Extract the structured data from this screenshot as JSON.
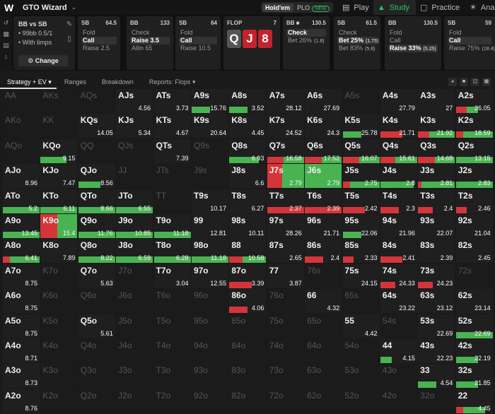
{
  "app": {
    "title": "GTO Wizard",
    "logo_letter": "W"
  },
  "game_toggle": {
    "holdem": "Hold'em",
    "plo": "PLO",
    "new_badge": "NEW"
  },
  "nav": {
    "play": "Play",
    "study": "Study",
    "practice": "Practice",
    "analyze": "Ana"
  },
  "setup": {
    "matchup": "BB vs SB",
    "stack": "99bb 0.5/1",
    "limps": "With limps",
    "change": "Change"
  },
  "actions": [
    {
      "pos": "SB",
      "stack": "64.5",
      "options": [
        {
          "label": "Fold"
        },
        {
          "label": "Call",
          "selected": true
        },
        {
          "label": "Raise 2.5"
        }
      ]
    },
    {
      "pos": "BB",
      "stack": "133",
      "options": [
        {
          "label": "Check"
        },
        {
          "label": "Raise 3.5",
          "selected": true
        },
        {
          "label": "Allin 65"
        }
      ]
    },
    {
      "pos": "SB",
      "stack": "64",
      "options": [
        {
          "label": "Fold"
        },
        {
          "label": "Call",
          "selected": true
        },
        {
          "label": "Raise 10.5"
        }
      ]
    },
    {
      "pos": "BB",
      "stack": "130.5",
      "options": [
        {
          "label": "Check",
          "selected": true
        },
        {
          "label": "Bet 26%",
          "pct": "(1.8)"
        }
      ]
    },
    {
      "pos": "SB",
      "stack": "61.5",
      "options": [
        {
          "label": "Check"
        },
        {
          "label": "Bet 25%",
          "pct": "(1.75)",
          "selected": true
        },
        {
          "label": "Bet 83%",
          "pct": "(5.8)"
        }
      ]
    },
    {
      "pos": "BB",
      "stack": "130.5",
      "options": [
        {
          "label": "Fold"
        },
        {
          "label": "Call"
        },
        {
          "label": "Raise 33%",
          "pct": "(5.25)",
          "selected": true
        }
      ]
    },
    {
      "pos": "SB",
      "stack": "59",
      "options": [
        {
          "label": "Fold"
        },
        {
          "label": "Call",
          "selected": true
        },
        {
          "label": "Raise 75%",
          "pct": "(18.4)"
        }
      ]
    }
  ],
  "flop": {
    "label": "FLOP",
    "pot": "7",
    "cards": [
      "Q",
      "J",
      "8"
    ]
  },
  "tabs": {
    "strategy": "Strategy + EV",
    "ranges": "Ranges",
    "breakdown": "Breakdown",
    "reports": "Reports: Flops"
  },
  "colors": {
    "red": "#d4353b",
    "green": "#49b352",
    "yellow": "#c9c93e"
  },
  "grid": [
    [
      {
        "h": "AA",
        "f": 1
      },
      {
        "h": "AKs",
        "f": 1
      },
      {
        "h": "AQs",
        "f": 1
      },
      {
        "h": "AJs",
        "ev": "4.56"
      },
      {
        "h": "ATs",
        "ev": "3.73"
      },
      {
        "h": "A9s",
        "ev": "15.76",
        "g": 0.5
      },
      {
        "h": "A8s",
        "ev": "3.52",
        "g": 0.5
      },
      {
        "h": "A7s",
        "ev": "28.12"
      },
      {
        "h": "A6s",
        "ev": "27.69"
      },
      {
        "h": "A5s",
        "f": 1
      },
      {
        "h": "A4s",
        "ev": "27.79"
      },
      {
        "h": "A3s",
        "ev": "27"
      },
      {
        "h": "A2s",
        "ev": "26.05",
        "r": 0.3,
        "g": 0.3
      }
    ],
    [
      {
        "h": "AKo",
        "f": 1
      },
      {
        "h": "KK",
        "f": 1
      },
      {
        "h": "KQs",
        "ev": "14.05"
      },
      {
        "h": "KJs",
        "ev": "5.34"
      },
      {
        "h": "KTs",
        "ev": "4.67"
      },
      {
        "h": "K9s",
        "ev": "20.64"
      },
      {
        "h": "K8s",
        "ev": "4.45"
      },
      {
        "h": "K7s",
        "ev": "24.52"
      },
      {
        "h": "K6s",
        "ev": "24.3"
      },
      {
        "h": "K5s",
        "ev": "25.78",
        "g": 0.5
      },
      {
        "h": "K4s",
        "ev": "21.71",
        "r": 0.6
      },
      {
        "h": "K3s",
        "ev": "21.92",
        "r": 0.3,
        "g": 0.7
      },
      {
        "h": "K2s",
        "ev": "18.59",
        "r": 0.2,
        "g": 0.8
      }
    ],
    [
      {
        "h": "AQo",
        "f": 1
      },
      {
        "h": "KQo",
        "ev": "9.15",
        "g": 0.7
      },
      {
        "h": "QQ",
        "f": 1
      },
      {
        "h": "QJs",
        "f": 1
      },
      {
        "h": "QTs",
        "ev": "7.39"
      },
      {
        "h": "Q9s",
        "f": 1
      },
      {
        "h": "Q8s",
        "ev": "6.93",
        "g": 0.8
      },
      {
        "h": "Q7s",
        "ev": "16.58",
        "r": 0.45,
        "g": 0.55
      },
      {
        "h": "Q6s",
        "ev": "17.52",
        "r": 0.45,
        "g": 0.55
      },
      {
        "h": "Q5s",
        "ev": "16.07",
        "r": 0.45,
        "g": 0.55
      },
      {
        "h": "Q4s",
        "ev": "15.61",
        "r": 0.4,
        "g": 0.6
      },
      {
        "h": "Q3s",
        "ev": "14.68",
        "r": 0.45,
        "g": 0.55
      },
      {
        "h": "Q2s",
        "ev": "13.15",
        "g": 1
      }
    ],
    [
      {
        "h": "AJo",
        "ev": "8.96"
      },
      {
        "h": "KJo",
        "ev": "7.47"
      },
      {
        "h": "QJo",
        "ev": "8.56",
        "g": 0.6
      },
      {
        "h": "JJ",
        "f": 1
      },
      {
        "h": "JTs",
        "f": 1
      },
      {
        "h": "J9s",
        "f": 1
      },
      {
        "h": "J8s",
        "ev": "6.6"
      },
      {
        "h": "J7s",
        "ev": "2.79",
        "full": 1,
        "r": 0.4,
        "g": 0.6
      },
      {
        "h": "J6s",
        "ev": "2.79",
        "full": 1,
        "g": 1
      },
      {
        "h": "J5s",
        "ev": "2.75",
        "r": 0.2,
        "g": 0.8
      },
      {
        "h": "J4s",
        "ev": "2.8",
        "g": 0.9
      },
      {
        "h": "J3s",
        "ev": "2.81",
        "r": 0.1,
        "g": 0.9
      },
      {
        "h": "J2s",
        "ev": "2.83",
        "g": 1
      }
    ],
    [
      {
        "h": "ATo",
        "ev": "5.2",
        "g": 1
      },
      {
        "h": "KTo",
        "ev": "6.11",
        "g": 1
      },
      {
        "h": "QTo",
        "ev": "8.66",
        "g": 1
      },
      {
        "h": "JTo",
        "ev": "6.55",
        "g": 1
      },
      {
        "h": "TT",
        "f": 1
      },
      {
        "h": "T9s",
        "ev": "10.17"
      },
      {
        "h": "T8s",
        "ev": "6.27"
      },
      {
        "h": "T7s",
        "ev": "2.37",
        "r": 1
      },
      {
        "h": "T6s",
        "ev": "2.39",
        "r": 1
      },
      {
        "h": "T5s",
        "ev": "2.42",
        "r": 0.6
      },
      {
        "h": "T4s",
        "ev": "2.3",
        "r": 0.5
      },
      {
        "h": "T3s",
        "ev": "2.4",
        "r": 0.4
      },
      {
        "h": "T2s",
        "ev": "2.46",
        "r": 0.3
      }
    ],
    [
      {
        "h": "A9o",
        "ev": "13.45",
        "g": 1
      },
      {
        "h": "K9o",
        "ev": "15.4",
        "full": 1,
        "r": 0.45,
        "g": 0.55
      },
      {
        "h": "Q9o",
        "ev": "11.76",
        "g": 1
      },
      {
        "h": "J9o",
        "ev": "10.85",
        "g": 1
      },
      {
        "h": "T9o",
        "ev": "11.18",
        "g": 1
      },
      {
        "h": "99",
        "ev": "12.81"
      },
      {
        "h": "98s",
        "ev": "10.11"
      },
      {
        "h": "97s",
        "ev": "28.26"
      },
      {
        "h": "96s",
        "ev": "21.71"
      },
      {
        "h": "95s",
        "ev": "22.06",
        "g": 0.5
      },
      {
        "h": "94s",
        "ev": "21.96"
      },
      {
        "h": "93s",
        "ev": "22.07"
      },
      {
        "h": "92s",
        "ev": "21.04"
      }
    ],
    [
      {
        "h": "A8o",
        "ev": "6.41",
        "r": 0.2,
        "g": 0.8
      },
      {
        "h": "K8o",
        "ev": "7.89"
      },
      {
        "h": "Q8o",
        "ev": "8.22",
        "g": 1
      },
      {
        "h": "J8o",
        "ev": "6.59",
        "g": 1
      },
      {
        "h": "T8o",
        "ev": "6.28",
        "g": 1
      },
      {
        "h": "98o",
        "ev": "11.18",
        "g": 1
      },
      {
        "h": "88",
        "ev": "10.58",
        "r": 0.35,
        "g": 0.65
      },
      {
        "h": "87s",
        "ev": "2.65"
      },
      {
        "h": "86s",
        "ev": "2.4",
        "r": 0.5
      },
      {
        "h": "85s",
        "ev": "2.33",
        "r": 0.3
      },
      {
        "h": "84s",
        "ev": "2.41",
        "r": 0.6
      },
      {
        "h": "83s",
        "ev": "2.39"
      },
      {
        "h": "82s",
        "ev": "2.45"
      }
    ],
    [
      {
        "h": "A7o",
        "ev": "8.75"
      },
      {
        "h": "K7o",
        "f": 1
      },
      {
        "h": "Q7o",
        "ev": "5.63"
      },
      {
        "h": "J7o",
        "f": 1
      },
      {
        "h": "T7o",
        "ev": "3.04"
      },
      {
        "h": "97o",
        "ev": "12.55"
      },
      {
        "h": "87o",
        "ev": "3.39",
        "r": 0.6
      },
      {
        "h": "77",
        "ev": "3.87"
      },
      {
        "h": "76s",
        "f": 1
      },
      {
        "h": "75s",
        "ev": "24.15"
      },
      {
        "h": "74s",
        "ev": "24.33",
        "r": 0.4
      },
      {
        "h": "73s",
        "ev": "24.23",
        "r": 0.4
      },
      {
        "h": "72s",
        "f": 1
      }
    ],
    [
      {
        "h": "A6o",
        "ev": "8.75"
      },
      {
        "h": "K6o",
        "f": 1
      },
      {
        "h": "Q6o",
        "f": 1
      },
      {
        "h": "J6o",
        "f": 1
      },
      {
        "h": "T6o",
        "f": 1
      },
      {
        "h": "96o",
        "f": 1
      },
      {
        "h": "86o",
        "ev": "4.06",
        "r": 0.5
      },
      {
        "h": "76o",
        "f": 1
      },
      {
        "h": "66",
        "ev": "4.32"
      },
      {
        "h": "65s",
        "f": 1
      },
      {
        "h": "64s",
        "ev": "23.22"
      },
      {
        "h": "63s",
        "ev": "23.12"
      },
      {
        "h": "62s",
        "ev": "23.14"
      }
    ],
    [
      {
        "h": "A5o",
        "ev": "8.75"
      },
      {
        "h": "K5o",
        "f": 1
      },
      {
        "h": "Q5o",
        "ev": "5.61"
      },
      {
        "h": "J5o",
        "f": 1
      },
      {
        "h": "T5o",
        "f": 1
      },
      {
        "h": "95o",
        "f": 1
      },
      {
        "h": "85o",
        "f": 1
      },
      {
        "h": "75o",
        "f": 1
      },
      {
        "h": "65o",
        "f": 1
      },
      {
        "h": "55",
        "ev": "4.42"
      },
      {
        "h": "54s",
        "f": 1
      },
      {
        "h": "53s",
        "ev": "22.69"
      },
      {
        "h": "52s",
        "ev": "22.69",
        "g": 1
      }
    ],
    [
      {
        "h": "A4o",
        "ev": "8.71"
      },
      {
        "h": "K4o",
        "f": 1
      },
      {
        "h": "Q4o",
        "f": 1
      },
      {
        "h": "J4o",
        "f": 1
      },
      {
        "h": "T4o",
        "f": 1
      },
      {
        "h": "94o",
        "f": 1
      },
      {
        "h": "84o",
        "f": 1
      },
      {
        "h": "74o",
        "f": 1
      },
      {
        "h": "64o",
        "f": 1
      },
      {
        "h": "54o",
        "f": 1
      },
      {
        "h": "44",
        "ev": "4.15",
        "g": 0.3
      },
      {
        "h": "43s",
        "ev": "22.23"
      },
      {
        "h": "42s",
        "ev": "22.19",
        "g": 0.6
      }
    ],
    [
      {
        "h": "A3o",
        "ev": "8.73"
      },
      {
        "h": "K3o",
        "f": 1
      },
      {
        "h": "Q3o",
        "f": 1
      },
      {
        "h": "J3o",
        "f": 1
      },
      {
        "h": "T3o",
        "f": 1
      },
      {
        "h": "93o",
        "f": 1
      },
      {
        "h": "83o",
        "f": 1
      },
      {
        "h": "73o",
        "f": 1
      },
      {
        "h": "63o",
        "f": 1
      },
      {
        "h": "53o",
        "f": 1
      },
      {
        "h": "43o",
        "f": 1
      },
      {
        "h": "33",
        "ev": "4.54",
        "g": 0.5
      },
      {
        "h": "32s",
        "ev": "21.85",
        "g": 0.6
      }
    ],
    [
      {
        "h": "A2o",
        "ev": "8.76"
      },
      {
        "h": "K2o",
        "f": 1
      },
      {
        "h": "Q2o",
        "f": 1
      },
      {
        "h": "J2o",
        "f": 1
      },
      {
        "h": "T2o",
        "f": 1
      },
      {
        "h": "92o",
        "f": 1
      },
      {
        "h": "82o",
        "f": 1
      },
      {
        "h": "72o",
        "f": 1
      },
      {
        "h": "62o",
        "f": 1
      },
      {
        "h": "52o",
        "f": 1
      },
      {
        "h": "42o",
        "f": 1
      },
      {
        "h": "32o",
        "f": 1
      },
      {
        "h": "22",
        "ev": "4.45",
        "r": 0.2,
        "g": 0.6
      }
    ]
  ]
}
